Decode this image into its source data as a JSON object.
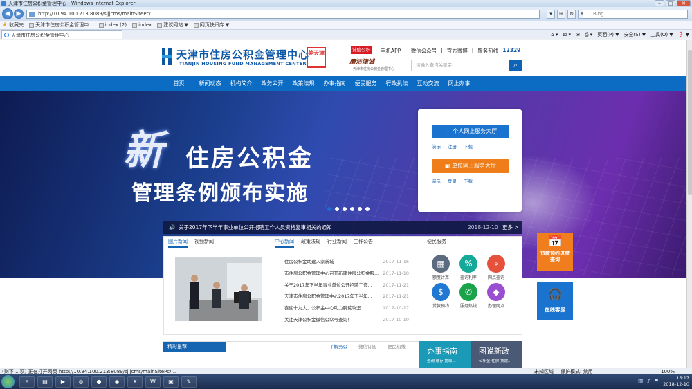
{
  "window": {
    "title": "天津市住房公积金管理中心 - Windows Internet Explorer"
  },
  "browser": {
    "address": "http://10.94.100.213:8089/sjjjcms/mainSitePc/",
    "search_placeholder": "Bing",
    "favorites_label": "收藏夹",
    "favorites": [
      "天津市住房公积金管理中...",
      "index (2)",
      "index",
      "建议网站 ▼",
      "网页快讯库 ▼"
    ],
    "tab_label": "天津市住房公积金管理中心",
    "commands": [
      "页面(P) ▼",
      "安全(S) ▼",
      "工具(O) ▼",
      "❓ ▼"
    ],
    "status_text": "(剩下 1 项) 正在打开网页 http://10.94.100.213:8089/sjjjcms/mainSitePc/...",
    "zoom": "100%",
    "protected": "保护模式: 禁用",
    "internet": "未知区域"
  },
  "site": {
    "title": "天津市住房公积金管理中心",
    "subtitle": "TIANJIN HOUSING FUND MANAGEMENT CENTER",
    "seal": "美天津",
    "slogan_badge": "诚信公积金",
    "slogan_calligraphy": "廉洁津诚",
    "slogan_small": "天津市住房公积金管理中心",
    "top_links": [
      "手机APP",
      "微信公众号",
      "官方微博",
      "服务热线"
    ],
    "hotline": "12329",
    "search_placeholder": "请输入查询关键字..."
  },
  "nav": [
    "首页",
    "新闻动态",
    "机构简介",
    "政务公开",
    "政策法规",
    "办事指南",
    "便民服务",
    "行政执法",
    "互动交流",
    "网上办事"
  ],
  "banner": {
    "big_char": "新",
    "line1": "住房公积金",
    "line2": "管理条例颁布实施"
  },
  "service": {
    "personal": "个人网上服务大厅",
    "personal_links": [
      "演示",
      "注册",
      "下载"
    ],
    "unit": "单位网上服务大厅",
    "unit_links": [
      "演示",
      "登录",
      "下载"
    ]
  },
  "notice": {
    "text": "关于2017年下半年事业单位公开招聘工作人员资格复审相关的通知",
    "date": "2018-12-10",
    "more": "更多 >"
  },
  "panel": {
    "left_tabs": [
      "图片新闻",
      "视频新闻"
    ],
    "news_tabs": [
      "中心新闻",
      "政策法规",
      "行业新闻",
      "工作公告"
    ],
    "news": [
      {
        "title": "住房公积金助建人家新城",
        "date": "2017-11-16"
      },
      {
        "title": "市住房公积金管理中心召开新建住房公积金服...",
        "date": "2017-11-10"
      },
      {
        "title": "关于2017年下半年事业单位公开招聘工作...",
        "date": "2017-11-21"
      },
      {
        "title": "天津市住房公积金管理中心2017年下半年...",
        "date": "2017-11-21"
      },
      {
        "title": "喜迎十九大，公积金中心助力脱贫攻坚...",
        "date": "2017-10-17"
      },
      {
        "title": "关注天津公积金微信公众号查询！",
        "date": "2017-10-10"
      }
    ],
    "convenience_title": "便民服务",
    "icons": [
      {
        "label": "额度计算",
        "icon": "calculator-icon",
        "color": "#5d6b80",
        "glyph": "▦"
      },
      {
        "label": "查询利率",
        "icon": "percent-icon",
        "color": "#15a99a",
        "glyph": "%"
      },
      {
        "label": "网点查询",
        "icon": "location-icon",
        "color": "#e6513b",
        "glyph": "⌖"
      },
      {
        "label": "贷款预约",
        "icon": "moneybag-icon",
        "color": "#1f78d1",
        "glyph": "$"
      },
      {
        "label": "服务热线",
        "icon": "phone-icon",
        "color": "#1aa34a",
        "glyph": "✆"
      },
      {
        "label": "办理网点",
        "icon": "tag-icon",
        "color": "#9a4fd1",
        "glyph": "◆"
      }
    ]
  },
  "side": {
    "loan": "贷款预约进度查询",
    "service": "在线客服"
  },
  "selection": {
    "head": "精彩推荐",
    "tabs": [
      "了解务公",
      "微信订阅",
      "便民热线"
    ],
    "guide": "办事指南",
    "guide_sub": "查询  缴存  提取...",
    "policy": "图说新政",
    "policy_sub": "公积金  住房  贷款..."
  },
  "clock": {
    "time": "15:17",
    "date": "2018-12-10"
  }
}
